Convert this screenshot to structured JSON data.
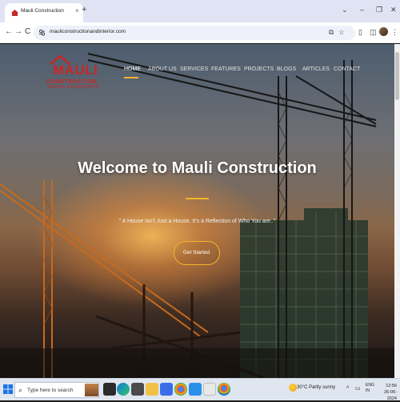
{
  "browser": {
    "tab_title": "Mauli Construction",
    "tab_close": "×",
    "new_tab": "+",
    "url": "mauliconstructionandinterior.com",
    "window_controls": [
      "⌄",
      "–",
      "❐",
      "✕"
    ],
    "nav_buttons": [
      "←",
      "→",
      "C"
    ]
  },
  "site": {
    "logo": {
      "main": "MAULI",
      "sub": "CONSTRUCTION",
      "tag": "SHELKE & ASSOCIATES"
    },
    "nav": {
      "items": [
        "HOME",
        "ABOUT US",
        "SERVICES",
        "FEATURES",
        "PROJECTS",
        "BLOGS",
        "ARTICLES",
        "CONTACT"
      ],
      "active": "HOME"
    },
    "hero": {
      "title": "Welcome to Mauli Construction",
      "quote": "\" A House Isn't Just a House, It's a Reflection of Who You are..\"",
      "cta": "Get Started"
    }
  },
  "taskbar": {
    "search_placeholder": "Type here to search",
    "weather": "30°C  Partly sunny",
    "lang_line1": "ENG",
    "lang_line2": "IN",
    "time": "12:56",
    "date": "26-06-2024"
  },
  "colors": {
    "accent": "#f3b52b",
    "logo": "#c62828",
    "taskbar": "#dfe6f0",
    "tabstrip": "#dfe3f3"
  }
}
